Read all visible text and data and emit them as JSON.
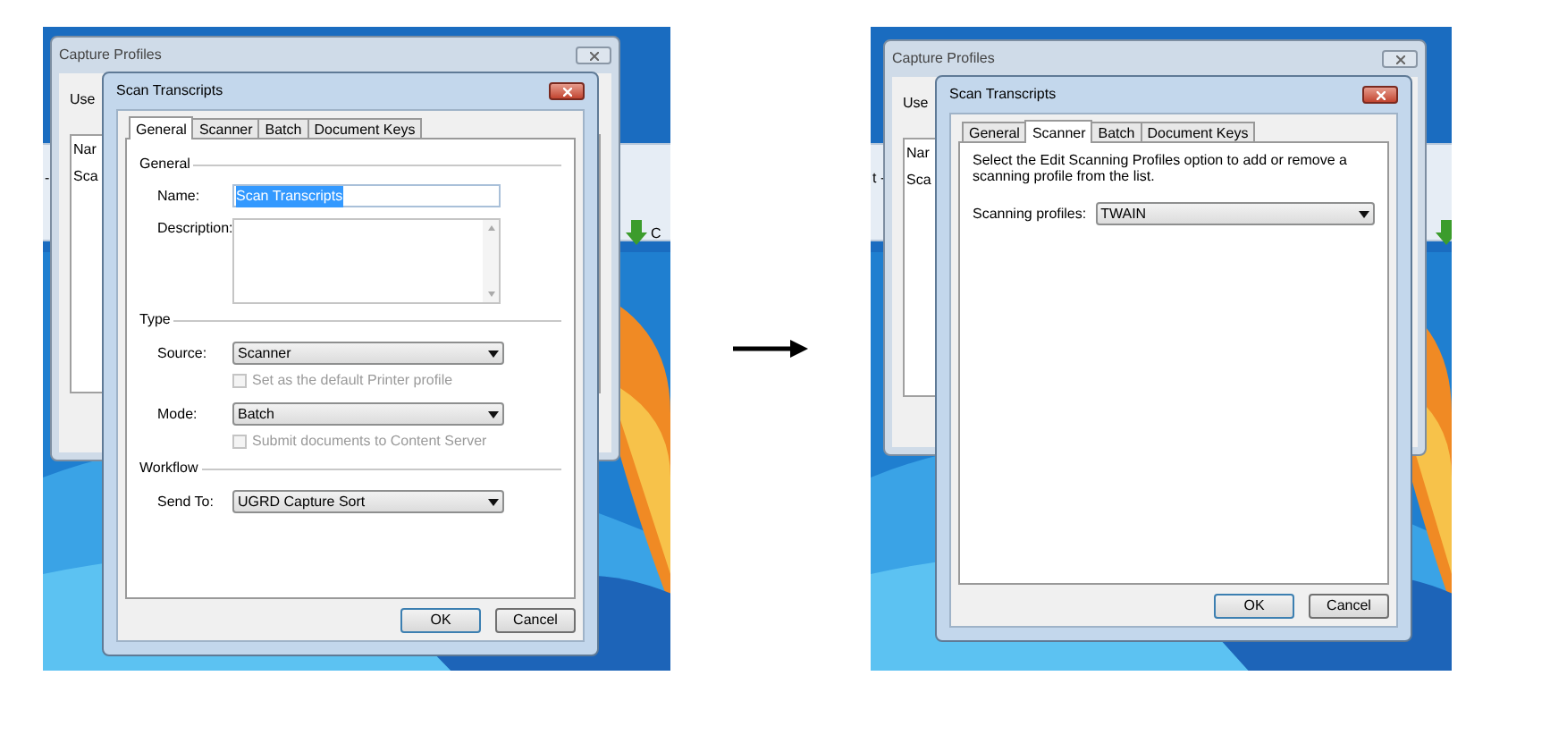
{
  "screenshots": [
    {
      "background_app": {
        "texts": [
          "-"
        ],
        "icon_label": "C"
      },
      "back_window": {
        "title": "Capture Profiles",
        "label": "Use",
        "list_header": "Nar",
        "list_rows": [
          "Sca"
        ]
      },
      "dialog": {
        "title": "Scan Transcripts",
        "tabs": [
          {
            "label": "General",
            "selected": true
          },
          {
            "label": "Scanner",
            "selected": false
          },
          {
            "label": "Batch",
            "selected": false
          },
          {
            "label": "Document Keys",
            "selected": false
          }
        ],
        "panel": {
          "kind": "general",
          "rows": [
            {
              "kind": "section",
              "label": "General"
            },
            {
              "kind": "text",
              "label": "Name:",
              "value": "Scan Transcripts",
              "text_selected": true
            },
            {
              "kind": "textarea",
              "label": "Description:"
            },
            {
              "kind": "section",
              "label": "Type"
            },
            {
              "kind": "select",
              "label": "Source:",
              "value": "Scanner"
            },
            {
              "kind": "checkbox",
              "label": "Set as the default Printer profile",
              "checked": false,
              "disabled": true
            },
            {
              "kind": "select",
              "label": "Mode:",
              "value": "Batch"
            },
            {
              "kind": "checkbox",
              "label": "Submit documents to Content Server",
              "checked": false,
              "disabled": true
            },
            {
              "kind": "section",
              "label": "Workflow"
            },
            {
              "kind": "select",
              "label": "Send To:",
              "value": "UGRD Capture Sort"
            }
          ]
        },
        "buttons": [
          {
            "label": "OK",
            "default": true
          },
          {
            "label": "Cancel",
            "default": false
          }
        ]
      }
    },
    {
      "background_app": {
        "texts": [
          "t -"
        ]
      },
      "back_window": {
        "title": "Capture Profiles",
        "label": "Use",
        "list_header": "Nar",
        "list_rows": [
          "Sca"
        ]
      },
      "dialog": {
        "title": "Scan Transcripts",
        "tabs": [
          {
            "label": "General",
            "selected": false
          },
          {
            "label": "Scanner",
            "selected": true
          },
          {
            "label": "Batch",
            "selected": false
          },
          {
            "label": "Document Keys",
            "selected": false
          }
        ],
        "panel": {
          "kind": "scanner",
          "rows": [
            {
              "kind": "note",
              "text": "Select the Edit Scanning Profiles option to add or remove a scanning profile from the list."
            },
            {
              "kind": "select",
              "label": "Scanning profiles:",
              "value": "TWAIN"
            }
          ]
        },
        "buttons": [
          {
            "label": "OK",
            "default": true
          },
          {
            "label": "Cancel",
            "default": false
          }
        ]
      }
    }
  ]
}
